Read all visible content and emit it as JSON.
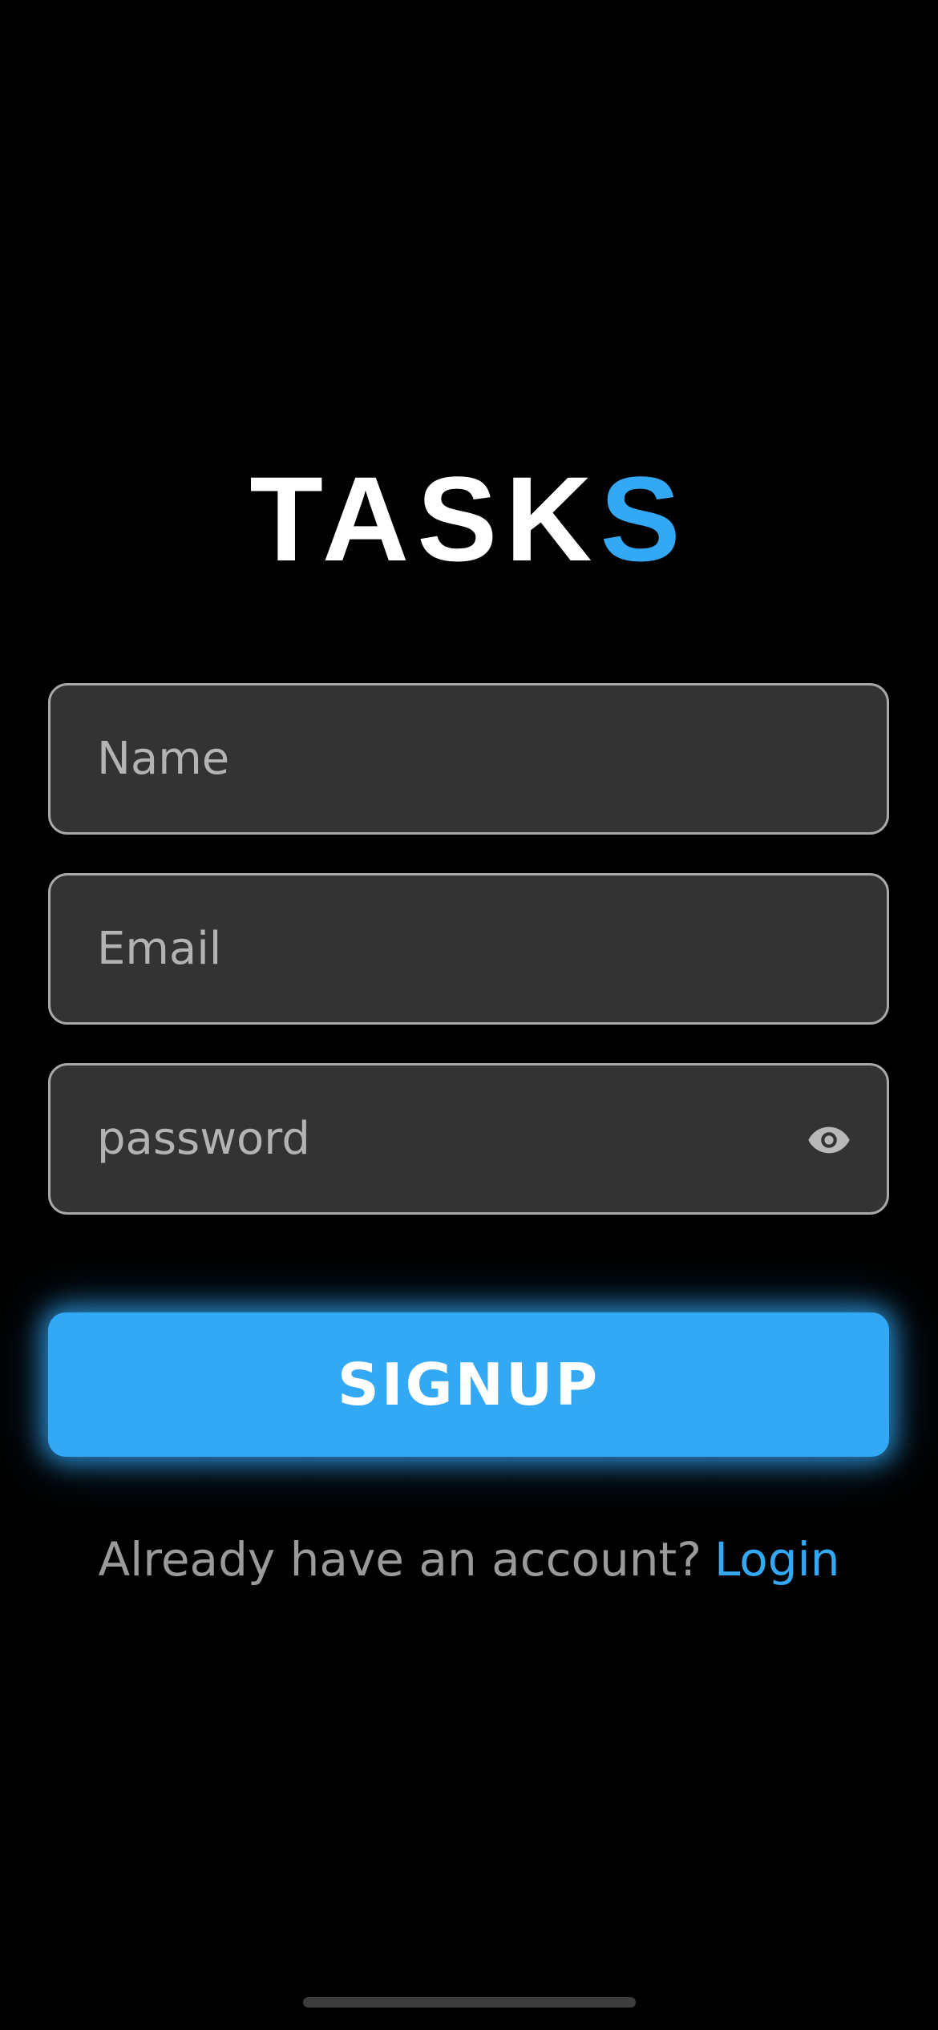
{
  "app": {
    "logo_main": "TASK",
    "logo_accent": "S"
  },
  "form": {
    "name": {
      "placeholder": "Name",
      "value": ""
    },
    "email": {
      "placeholder": "Email",
      "value": ""
    },
    "password": {
      "placeholder": "password",
      "value": "",
      "toggle_icon": "eye-icon"
    }
  },
  "signup_button": {
    "label": "SIGNUP"
  },
  "footer": {
    "prompt": "Already have an account?",
    "login_link": "Login"
  },
  "colors": {
    "background": "#000000",
    "accent": "#33a8f5",
    "field_background": "#333333",
    "field_border": "#a8a8a8",
    "muted_text": "#9a9a9a"
  }
}
